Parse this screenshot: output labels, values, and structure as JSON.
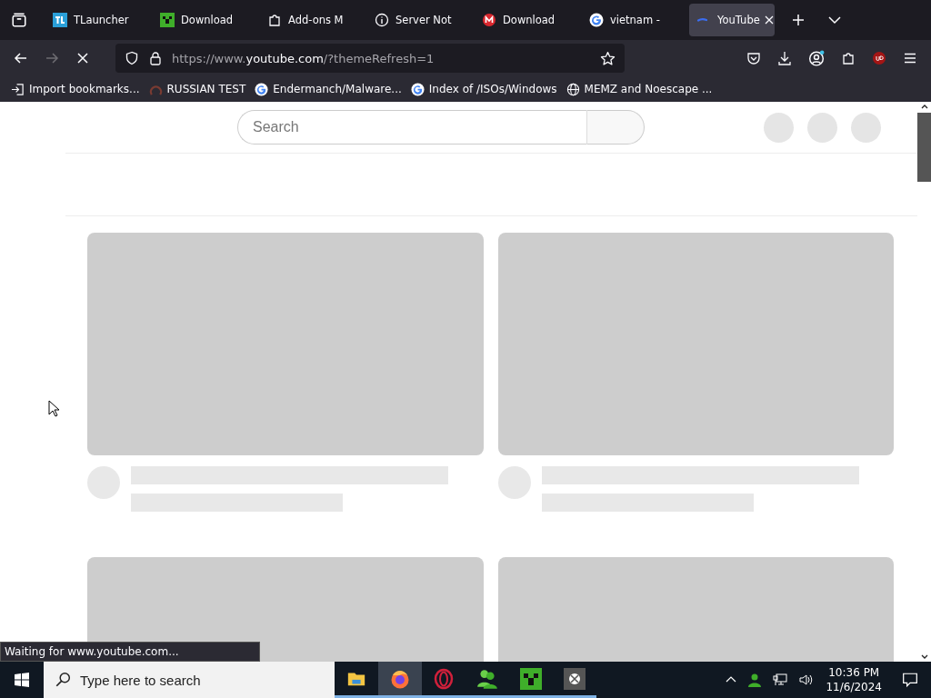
{
  "tabs": [
    {
      "label": "TLauncher",
      "kind": "tl",
      "selected": false
    },
    {
      "label": "Download",
      "kind": "creeper",
      "selected": false
    },
    {
      "label": "Add-ons M",
      "kind": "puzzle",
      "selected": false
    },
    {
      "label": "Server Not",
      "kind": "info",
      "selected": false
    },
    {
      "label": "Download",
      "kind": "mega",
      "selected": false
    },
    {
      "label": "vietnam -",
      "kind": "google",
      "selected": false
    },
    {
      "label": "YouTube",
      "kind": "loading",
      "selected": true
    }
  ],
  "address": {
    "prefix": "https://www.",
    "domain": "youtube.com",
    "suffix": "/?themeRefresh=1"
  },
  "bookmarks": [
    {
      "label": "Import bookmarks...",
      "kind": "import"
    },
    {
      "label": "RUSSIAN TEST",
      "kind": "ring"
    },
    {
      "label": "Endermanch/Malware...",
      "kind": "google"
    },
    {
      "label": "Index of /ISOs/Windows",
      "kind": "google"
    },
    {
      "label": "MEMZ and Noescape ...",
      "kind": "globe"
    }
  ],
  "page": {
    "search": {
      "placeholder": "Search"
    }
  },
  "status": "Waiting for www.youtube.com...",
  "taskbar": {
    "search": {
      "placeholder": "Type here to search"
    },
    "apps": [
      {
        "kind": "folder",
        "selected": false
      },
      {
        "kind": "firefox",
        "selected": true
      },
      {
        "kind": "opera",
        "selected": false
      },
      {
        "kind": "people",
        "selected": false
      },
      {
        "kind": "creeper",
        "selected": false
      },
      {
        "kind": "xbox",
        "selected": false
      }
    ],
    "time": "10:36 PM",
    "date": "11/6/2024"
  }
}
